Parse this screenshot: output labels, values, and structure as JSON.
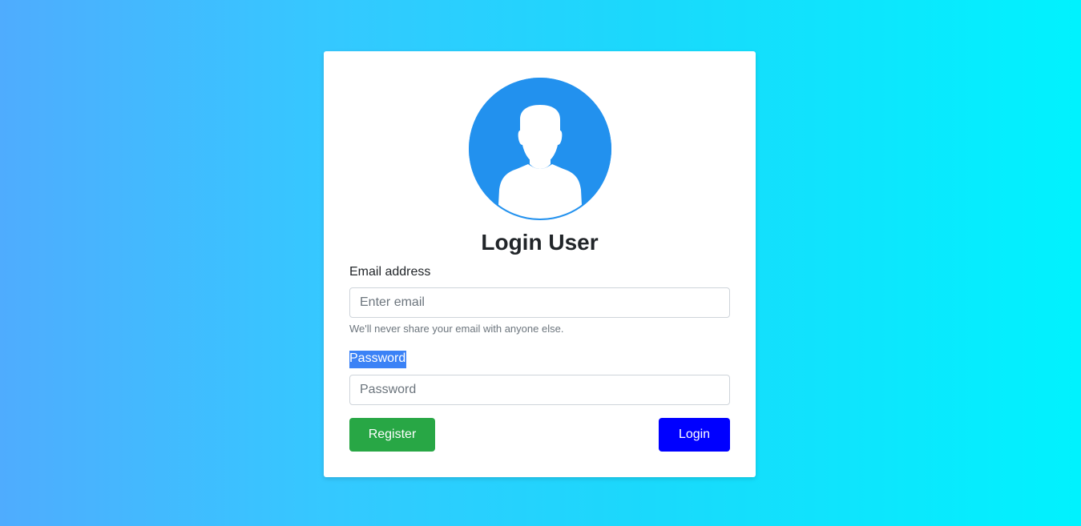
{
  "login_form": {
    "title": "Login User",
    "email": {
      "label": "Email address",
      "placeholder": "Enter email",
      "help_text": "We'll never share your email with anyone else."
    },
    "password": {
      "label": "Password",
      "placeholder": "Password"
    },
    "register_label": "Register",
    "login_label": "Login"
  },
  "avatar": {
    "icon": "user-avatar-icon",
    "color": "#2291ee"
  },
  "colors": {
    "register_button": "#28a745",
    "login_button": "#0000ff",
    "background_gradient_start": "#4facfe",
    "background_gradient_end": "#00f2fe"
  }
}
